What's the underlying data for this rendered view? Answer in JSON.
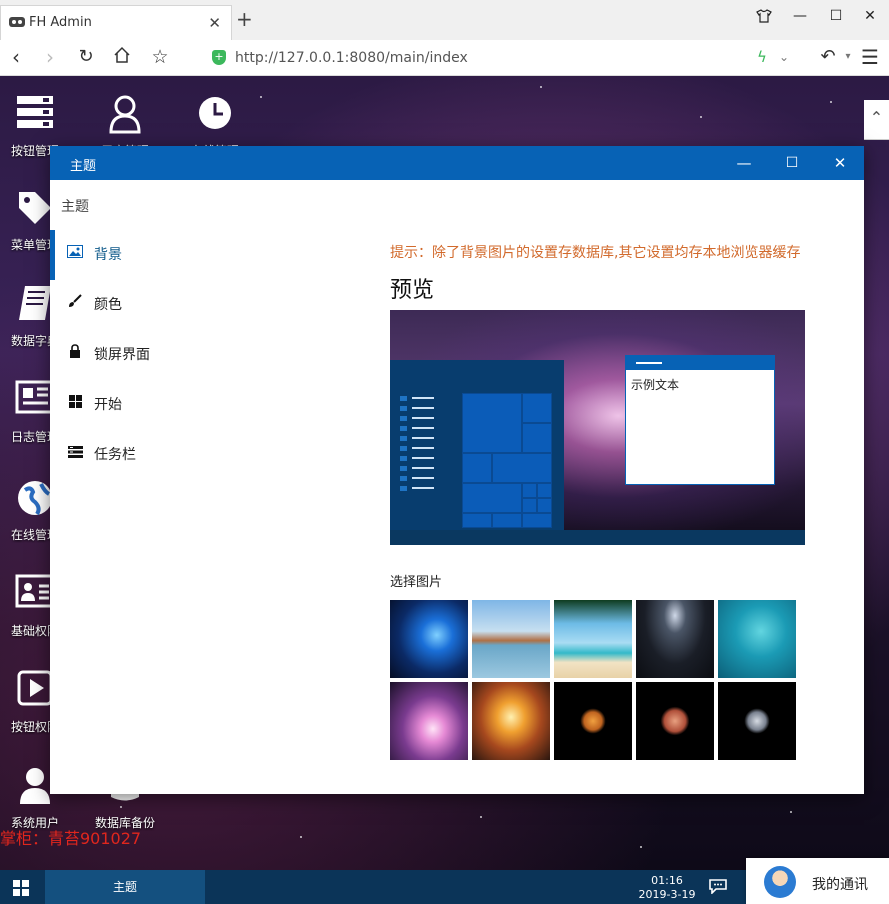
{
  "browser": {
    "tab_title": "FH Admin",
    "url": "http://127.0.0.1:8080/main/index"
  },
  "desktop": {
    "icons": [
      {
        "label": "按钮管理",
        "icon": "server-icon"
      },
      {
        "label": "用户管理",
        "icon": "user-icon"
      },
      {
        "label": "在线管理",
        "icon": "clock-icon"
      },
      {
        "label": "菜单管理",
        "icon": "tag-icon"
      },
      {
        "label": "数据字典",
        "icon": "book-icon"
      },
      {
        "label": "日志管理",
        "icon": "newspaper-icon"
      },
      {
        "label": "在线管理",
        "icon": "globe-icon"
      },
      {
        "label": "基础权限",
        "icon": "id-card-icon"
      },
      {
        "label": "按钮权限",
        "icon": "play-icon"
      },
      {
        "label": "系统用户",
        "icon": "person-icon"
      },
      {
        "label": "数据库备份",
        "icon": "database-icon"
      }
    ],
    "watermark": "掌柜：青苔901027"
  },
  "modal": {
    "title": "主题",
    "breadcrumb": "主题",
    "menu": [
      {
        "label": "背景",
        "icon": "image-icon",
        "active": true
      },
      {
        "label": "颜色",
        "icon": "brush-icon"
      },
      {
        "label": "锁屏界面",
        "icon": "lock-icon"
      },
      {
        "label": "开始",
        "icon": "windows-icon"
      },
      {
        "label": "任务栏",
        "icon": "taskbar-icon"
      }
    ],
    "hint": "提示：除了背景图片的设置存数据库,其它设置均存本地浏览器缓存",
    "preview_title": "预览",
    "preview_sample_text": "示例文本",
    "choose_label": "选择图片",
    "thumbnails": [
      "windows-blue",
      "sea-rocks",
      "palm-beach",
      "night-sky",
      "underwater",
      "aurora-pink",
      "sunset-sea",
      "planet-orange",
      "planet-red",
      "planet-gray"
    ]
  },
  "taskbar": {
    "task_label": "主题",
    "time": "01:16",
    "date": "2019-3-19",
    "im_label": "我的通讯"
  },
  "colors": {
    "accent": "#0762b5",
    "hint": "#d26a2c",
    "watermark": "#e0261d",
    "taskbar": "#0b3458"
  }
}
